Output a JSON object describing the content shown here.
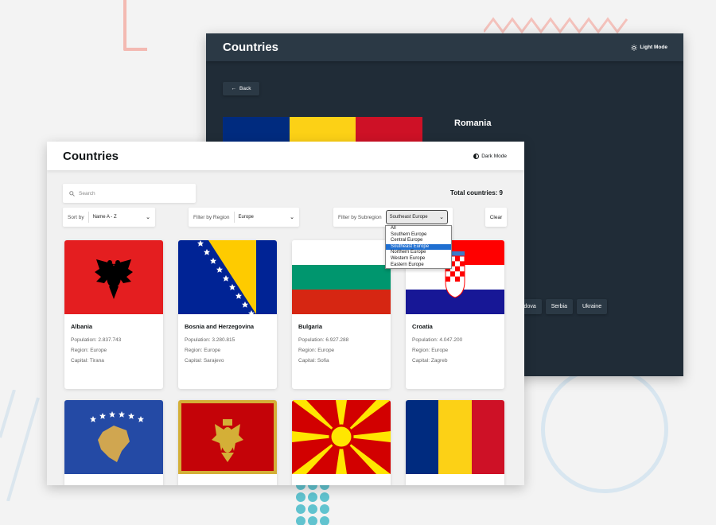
{
  "colors": {
    "dark_bg": "#202c37",
    "dark_element": "#2b3945",
    "light_bg": "#f1f1f1",
    "text_dark": "#111517",
    "highlight": "#1f6fd1"
  },
  "dark_window": {
    "title": "Countries",
    "mode_toggle": "Light Mode",
    "back_label": "Back",
    "country_name": "Romania",
    "border_countries": [
      "ldova",
      "Serbia",
      "Ukraine"
    ],
    "flag_colors": [
      "#002b7f",
      "#fcd116",
      "#ce1126"
    ]
  },
  "light_window": {
    "title": "Countries",
    "mode_toggle": "Dark Mode",
    "search": {
      "placeholder": "Search",
      "icon": "search-icon"
    },
    "total_countries": "Total countries: 9",
    "sort": {
      "label": "Sort by",
      "value": "Name A - Z"
    },
    "region": {
      "label": "Filter by Region",
      "value": "Europe"
    },
    "subregion": {
      "label": "Filter by Subregion",
      "value": "Southeast Europe",
      "options": [
        "All",
        "Southern Europe",
        "Central Europe",
        "Southeast Europe",
        "Northern Europe",
        "Western Europe",
        "Eastern Europe"
      ],
      "selected_index": 3
    },
    "clear_label": "Clear",
    "cards": [
      {
        "name": "Albania",
        "population": "Population: 2.837.743",
        "region": "Region: Europe",
        "capital": "Capital: Tirana",
        "flag": "albania"
      },
      {
        "name": "Bosnia and Herzegovina",
        "population": "Population: 3.280.815",
        "region": "Region: Europe",
        "capital": "Capital: Sarajevo",
        "flag": "bosnia"
      },
      {
        "name": "Bulgaria",
        "population": "Population: 6.927.288",
        "region": "Region: Europe",
        "capital": "Capital: Sofia",
        "flag": "bulgaria"
      },
      {
        "name": "Croatia",
        "population": "Population: 4.047.200",
        "region": "Region: Europe",
        "capital": "Capital: Zagreb",
        "flag": "croatia"
      },
      {
        "name": "",
        "population": "",
        "region": "",
        "capital": "",
        "flag": "kosovo"
      },
      {
        "name": "",
        "population": "",
        "region": "",
        "capital": "",
        "flag": "montenegro"
      },
      {
        "name": "",
        "population": "",
        "region": "",
        "capital": "",
        "flag": "north-macedonia"
      },
      {
        "name": "",
        "population": "",
        "region": "",
        "capital": "",
        "flag": "romania"
      }
    ]
  }
}
